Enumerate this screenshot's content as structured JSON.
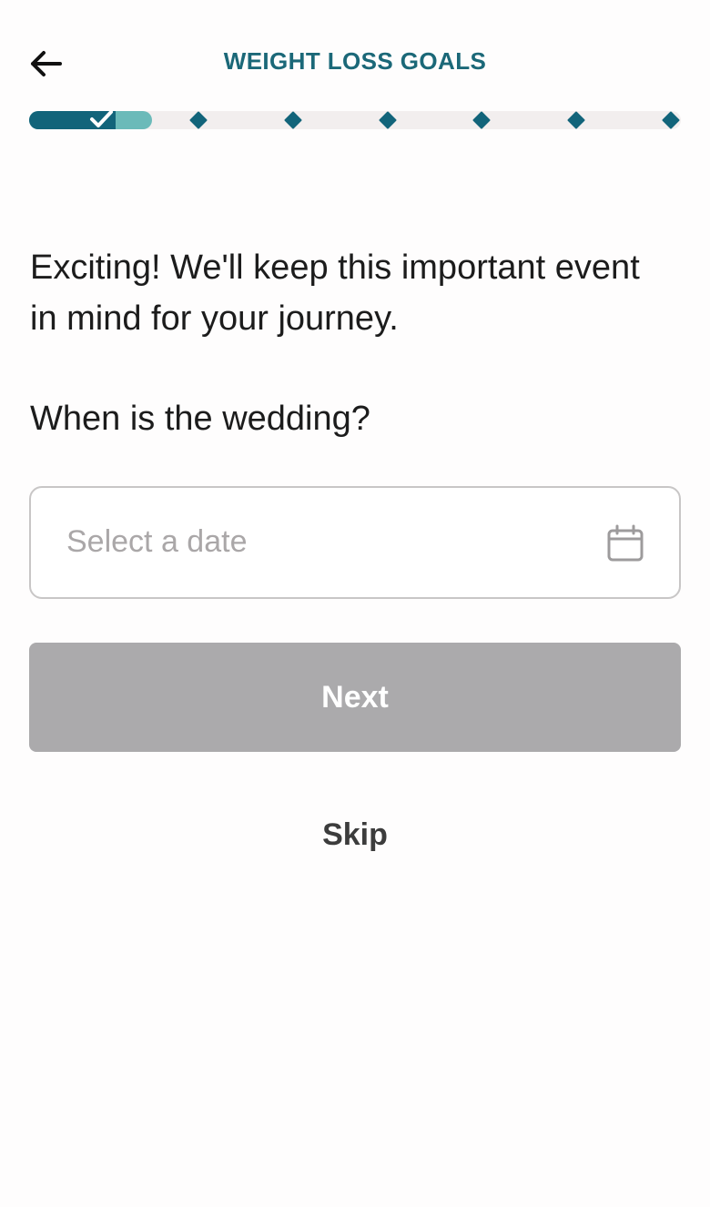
{
  "header": {
    "title": "WEIGHT LOSS GOALS",
    "back_icon": "arrow-left-icon"
  },
  "progress": {
    "completed_steps": 1,
    "total_steps": 7,
    "active_color": "#12647a",
    "fill_color": "#6bbab9",
    "track_color": "#f2eeee"
  },
  "content": {
    "lead_text": "Exciting! We'll keep this important event in mind for your journey.",
    "question": "When is the wedding?"
  },
  "date_input": {
    "placeholder": "Select a date",
    "value": "",
    "icon": "calendar-icon"
  },
  "actions": {
    "next_label": "Next",
    "next_disabled": true,
    "skip_label": "Skip"
  }
}
